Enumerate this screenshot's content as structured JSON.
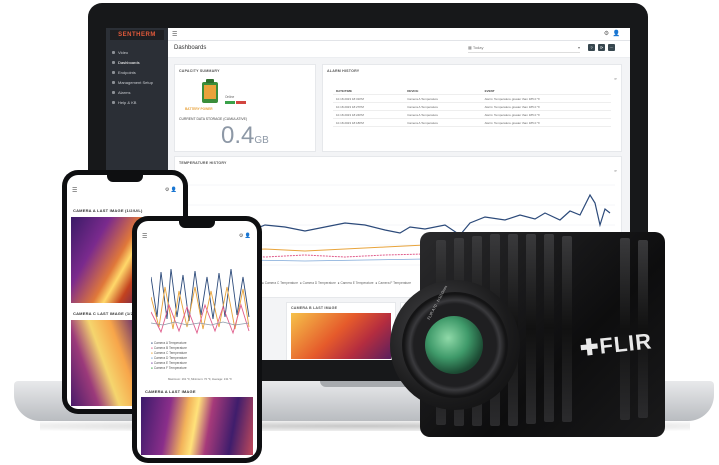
{
  "app": {
    "brand": "SENTHERM",
    "nav": [
      "Video",
      "Dashboards",
      "Endpoints",
      "Management Setup",
      "Alarms",
      "Help & KB"
    ],
    "active_nav": 1,
    "page_title": "Dashboards",
    "date_filter": "Today",
    "header_buttons": [
      "?",
      "⟳",
      "⋯"
    ]
  },
  "capacity_card": {
    "title": "CAPACITY SUMMARY",
    "battery_label": "BATTERY POWER",
    "battery_status": "Online",
    "storage_label": "CURRENT DATA STORAGE (CUMULATIVE)",
    "storage_value": "0.4",
    "storage_unit": "GB"
  },
  "alarm_card": {
    "title": "ALARM HISTORY",
    "columns": [
      "DATE/TIME",
      "DEVICE",
      "EVENT"
    ],
    "rows": [
      [
        "10.18.2023 18:31PM",
        "Camera A Temperature",
        "Alarm: Temperature greater than 185.0 °F"
      ],
      [
        "10.18.2023 18:27PM",
        "Camera A Temperature",
        "Alarm: Temperature greater than 185.0 °F"
      ],
      [
        "10.18.2023 18:24PM",
        "Camera A Temperature",
        "Alarm: Temperature greater than 185.0 °F"
      ],
      [
        "10.18.2023 18:18PM",
        "Camera A Temperature",
        "Alarm: Temperature greater than 185.0 °F"
      ]
    ]
  },
  "history_card": {
    "title": "TEMPERATURE HISTORY",
    "legend": [
      "Camera A Temperature",
      "Camera B Temperature",
      "Camera C Temperature",
      "Camera D Temperature",
      "Camera E Temperature",
      "Camera F Temperature"
    ]
  },
  "thumb_labels": [
    "CAMERA B LAST IMAGE",
    "CAMERA C LAST IMAGE"
  ],
  "phone_left": {
    "title1": "CAMERA A LAST IMAGE (1/2/U/L)",
    "title2": "CAMERA C LAST IMAGE (1/2/U/L)"
  },
  "phone_right": {
    "legend": [
      "Camera A Temperature",
      "Camera B Temperature",
      "Camera C Temperature",
      "Camera D Temperature",
      "Camera E Temperature",
      "Camera F Temperature"
    ],
    "footer": "Maximum: 191 °F, Minimum: 70 °F, Average: 131 °F",
    "title": "CAMERA A LAST IMAGE"
  },
  "camera": {
    "brand": "FLIR",
    "lens_text": "FLIR A70 · f=10.0mm"
  },
  "colors": {
    "sidebar": "#2b2f36",
    "accent_brand": "#e25a3b",
    "line_blue": "#2c4a7a",
    "line_orange": "#e8a43c",
    "line_pink": "#e05c8b"
  }
}
